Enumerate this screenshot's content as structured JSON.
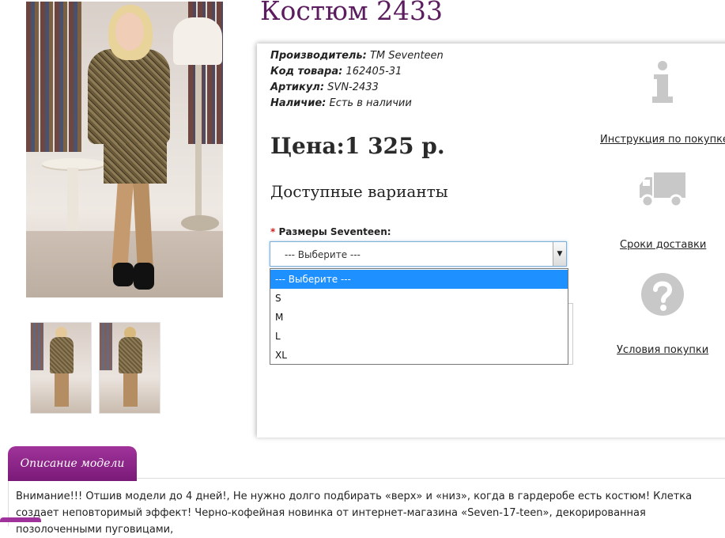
{
  "product": {
    "title": "Костюм 2433",
    "manufacturer_label": "Производитель:",
    "manufacturer_value": "ТМ Seventeen",
    "code_label": "Код товара:",
    "code_value": "162405-31",
    "article_label": "Артикул:",
    "article_value": "SVN-2433",
    "availability_label": "Наличие:",
    "availability_value": "Есть в наличии",
    "price": "Цена:1 325 р.",
    "variants_heading": "Доступные варианты"
  },
  "options": {
    "required_mark": "*",
    "size_label": "Размеры Seventeen:",
    "selected": "--- Выберите ---",
    "items": [
      "--- Выберите ---",
      "S",
      "M",
      "L",
      "XL"
    ]
  },
  "sidebar": {
    "instruction_link": "Инструкция по покупке",
    "delivery_link": "Сроки доставки",
    "conditions_link": "Условия покупки",
    "icons": [
      "info-icon",
      "truck-icon",
      "question-icon"
    ]
  },
  "description": {
    "tab_label": "Описание модели",
    "text": "Внимание!!! Отшив модели до 4 дней!, Не нужно долго подбирать «верх» и «низ», когда в гардеробе есть костюм! Клетка создает неповторимый эффект! Черно-кофейная новинка от интернет-магазина «Seven-17-teen», декорированная позолоченными пуговицами,"
  },
  "colors": {
    "accent": "#5b1d5e",
    "tab": "#8f2a8c",
    "select_highlight": "#1e90ff"
  }
}
